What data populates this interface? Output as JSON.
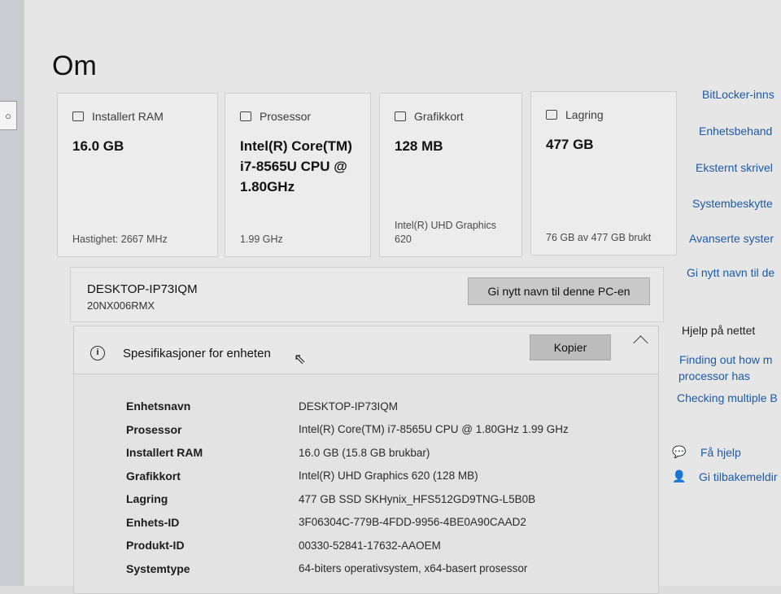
{
  "page_title": "Om",
  "cards": {
    "ram": {
      "label": "Installert RAM",
      "value": "16.0 GB",
      "foot": "Hastighet: 2667 MHz",
      "icon": "memory-icon"
    },
    "cpu": {
      "label": "Prosessor",
      "value": "Intel(R) Core(TM) i7-8565U CPU @ 1.80GHz",
      "foot": "1.99 GHz",
      "icon": "processor-icon"
    },
    "gpu": {
      "label": "Grafikkort",
      "value": "128 MB",
      "foot": "Intel(R) UHD Graphics 620",
      "icon": "graphics-card-icon"
    },
    "disk": {
      "label": "Lagring",
      "value": "477 GB",
      "foot": "76 GB av 477 GB brukt",
      "icon": "storage-icon"
    }
  },
  "device": {
    "name": "DESKTOP-IP73IQM",
    "model": "20NX006RMX",
    "rename_label": "Gi nytt navn til denne PC-en"
  },
  "specs": {
    "title": "Spesifikasjoner for enheten",
    "copy_label": "Kopier",
    "info_glyph": "i",
    "cursor_glyph": "⇖",
    "rows": [
      {
        "key": "Enhetsnavn",
        "value": "DESKTOP-IP73IQM"
      },
      {
        "key": "Prosessor",
        "value": "Intel(R) Core(TM) i7-8565U CPU @ 1.80GHz   1.99 GHz"
      },
      {
        "key": "Installert RAM",
        "value": "16.0 GB (15.8 GB brukbar)"
      },
      {
        "key": "Grafikkort",
        "value": "Intel(R) UHD Graphics 620 (128 MB)"
      },
      {
        "key": "Lagring",
        "value": "477 GB SSD SKHynix_HFS512GD9TNG-L5B0B"
      },
      {
        "key": "Enhets-ID",
        "value": "3F06304C-779B-4FDD-9956-4BE0A90CAAD2"
      },
      {
        "key": "Produkt-ID",
        "value": "00330-52841-17632-AAOEM"
      },
      {
        "key": "Systemtype",
        "value": "64-biters operativsystem, x64-basert prosessor"
      }
    ]
  },
  "right": {
    "links": [
      "BitLocker-inns",
      "Enhetsbehand",
      "Eksternt skrivel",
      "Systembeskytte",
      "Avanserte syster",
      "Gi nytt navn til de"
    ],
    "help_heading": "Hjelp på nettet",
    "help_links": [
      "Finding out how m",
      "processor has",
      "Checking multiple B"
    ],
    "get_help": "Få hjelp",
    "feedback": "Gi tilbakemeldir"
  },
  "left": {
    "search_glyph": "○"
  }
}
